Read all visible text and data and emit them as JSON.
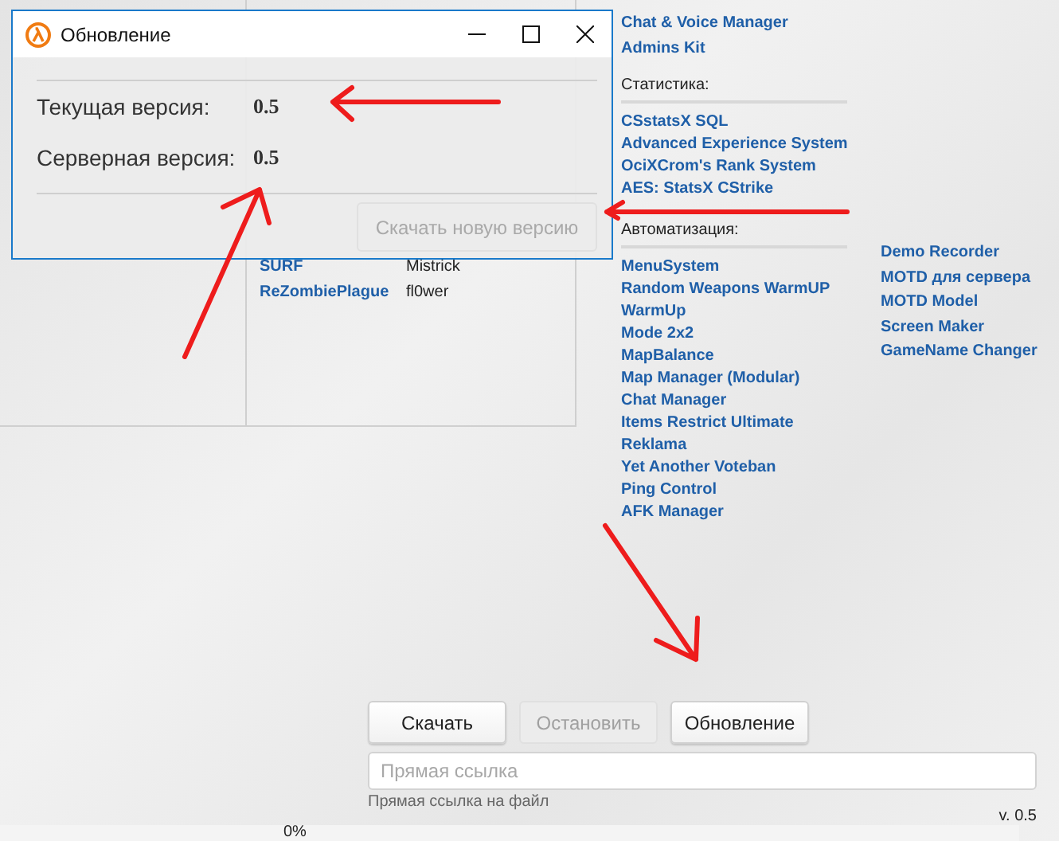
{
  "plugins_table": {
    "rows": [
      {
        "name": "SURF",
        "author": "Mistrick"
      },
      {
        "name": "ReZombiePlague",
        "author": "fl0wer"
      }
    ]
  },
  "links_top": [
    "Chat & Voice Manager",
    "Admins Kit"
  ],
  "sections": [
    {
      "title": "Статистика:",
      "items": [
        "CSstatsX SQL",
        "Advanced Experience System",
        "OciXCrom's Rank System",
        "AES: StatsX CStrike"
      ]
    },
    {
      "title": "Автоматизация:",
      "items": [
        "MenuSystem",
        "Random Weapons WarmUP",
        "WarmUp",
        "Mode 2x2",
        "MapBalance",
        "Map Manager (Modular)",
        "Chat Manager",
        "Items Restrict Ultimate",
        "Reklama",
        "Yet Another Voteban",
        "Ping Control",
        "AFK Manager"
      ]
    }
  ],
  "links_column_2": [
    "Demo Recorder",
    "MOTD для сервера",
    "MOTD Model",
    "Screen Maker",
    "GameName Changer"
  ],
  "buttons": [
    {
      "label": "Скачать",
      "disabled": false
    },
    {
      "label": "Остановить",
      "disabled": true
    },
    {
      "label": "Обновление",
      "disabled": false
    }
  ],
  "link_field": {
    "placeholder": "Прямая ссылка",
    "hint": "Прямая ссылка на файл"
  },
  "version": "v. 0.5",
  "progress": {
    "level": 0,
    "reading": "0%"
  },
  "dialog": {
    "title": "Обновление",
    "rows": [
      {
        "label": "Текущая версия:",
        "value": "0.5"
      },
      {
        "label": "Серверная версия:",
        "value": "0.5"
      }
    ],
    "download_button": {
      "label": "Скачать новую версию",
      "disabled": true
    }
  }
}
